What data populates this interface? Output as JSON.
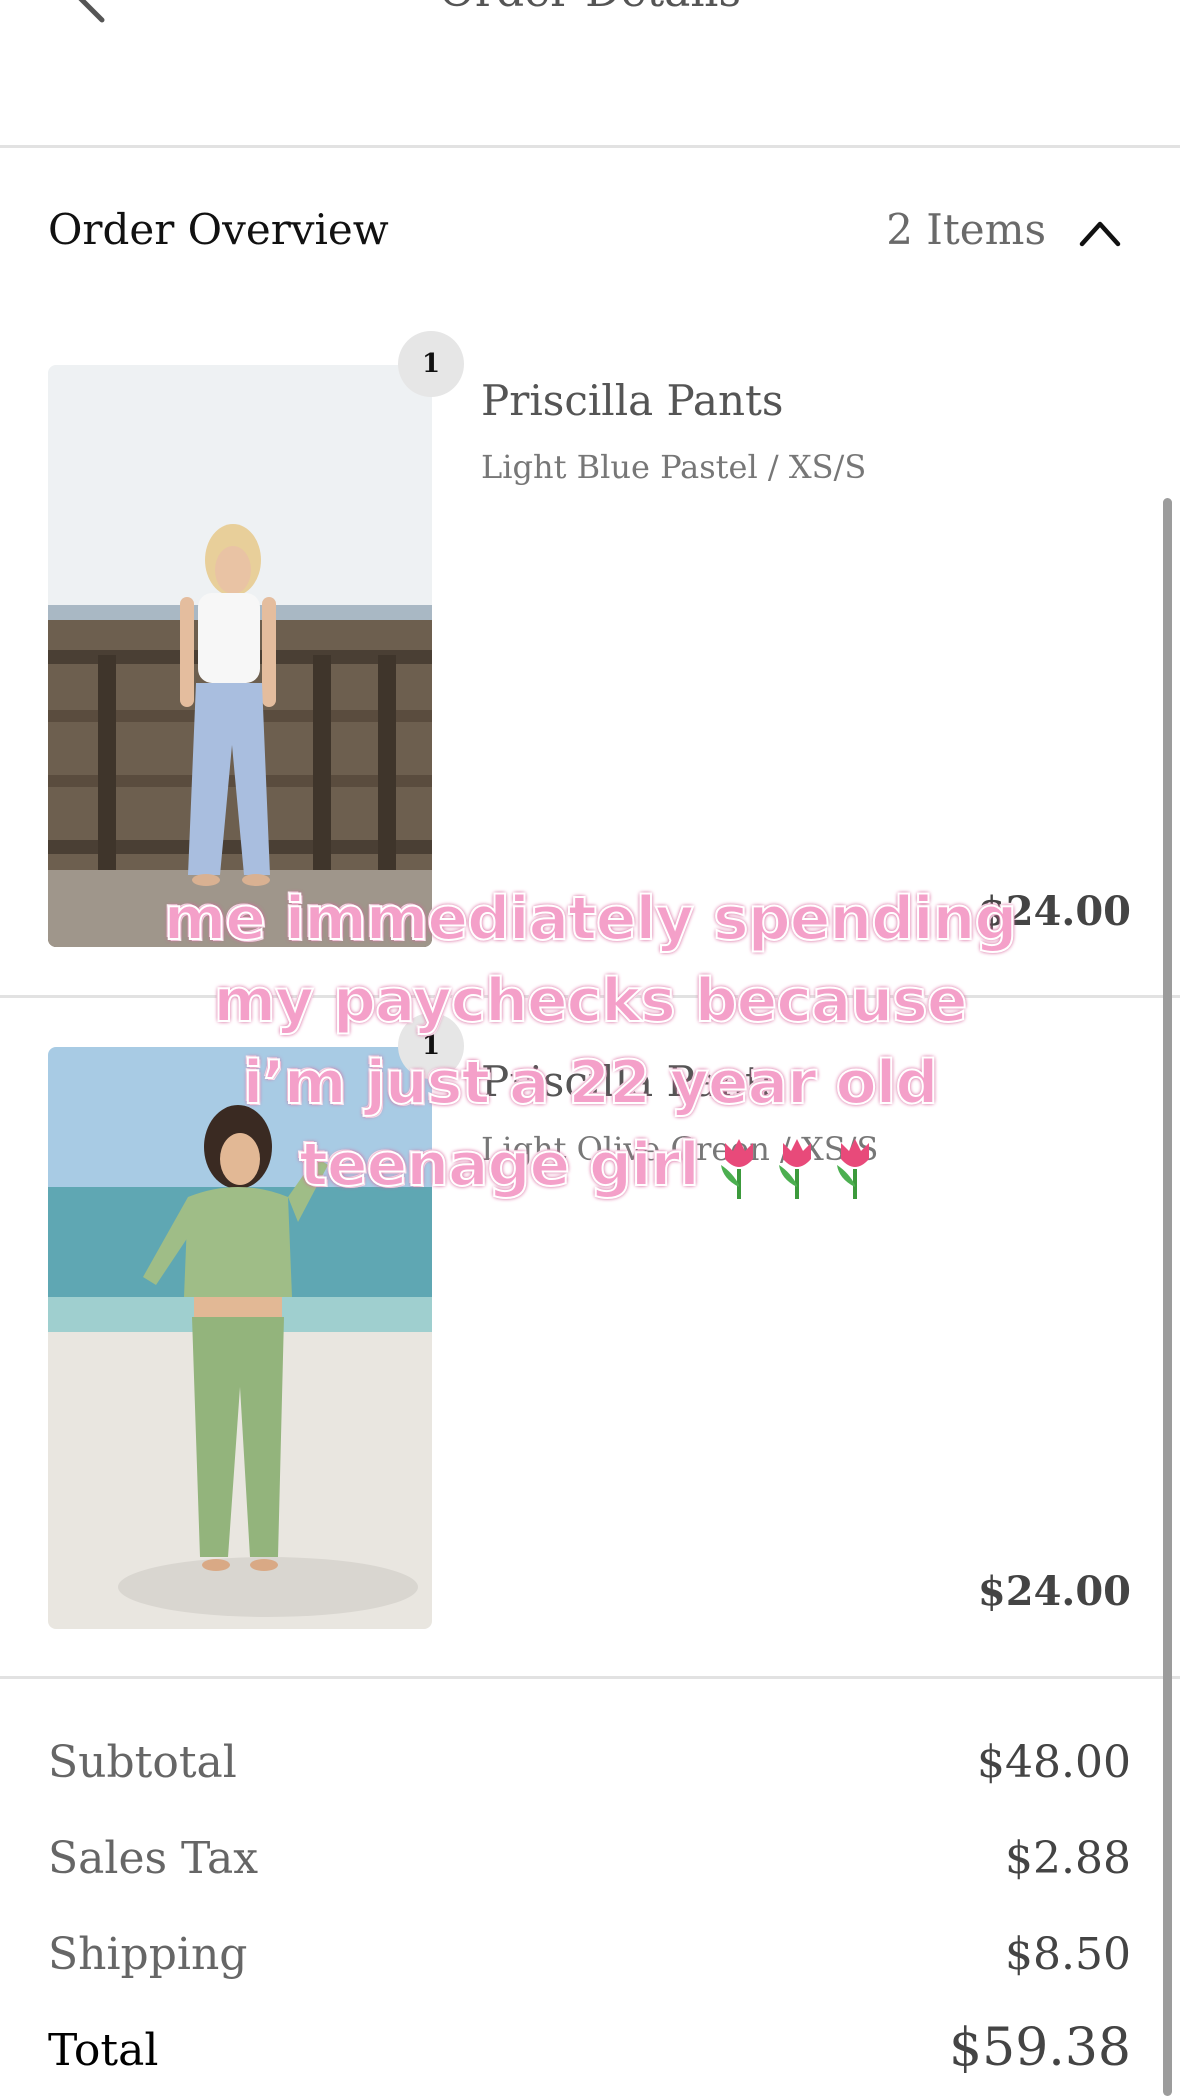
{
  "header": {
    "title": "Order Details"
  },
  "overview": {
    "label": "Order Overview",
    "count": "2 Items"
  },
  "items": [
    {
      "qty": "1",
      "name": "Priscilla Pants",
      "variant": "Light Blue Pastel / XS/S",
      "price": "$24.00",
      "image": "model-in-light-blue-pants-on-boardwalk"
    },
    {
      "qty": "1",
      "name": "Priscilla Pants",
      "variant": "Light Olive Green / XS/S",
      "price": "$24.00",
      "image": "model-in-olive-green-set-on-beach"
    }
  ],
  "summary": {
    "subtotal_label": "Subtotal",
    "subtotal": "$48.00",
    "tax_label": "Sales Tax",
    "tax": "$2.88",
    "shipping_label": "Shipping",
    "shipping": "$8.50",
    "total_label": "Total",
    "total": "$59.38"
  },
  "caption": {
    "lines": [
      "me immediately spending",
      "my paychecks because",
      "i’m just a 22 year old",
      "teenage girl"
    ],
    "emoji": "tulip-icon x3",
    "fill_color": "#f4a0c9",
    "outline_color": "#d8679d"
  }
}
